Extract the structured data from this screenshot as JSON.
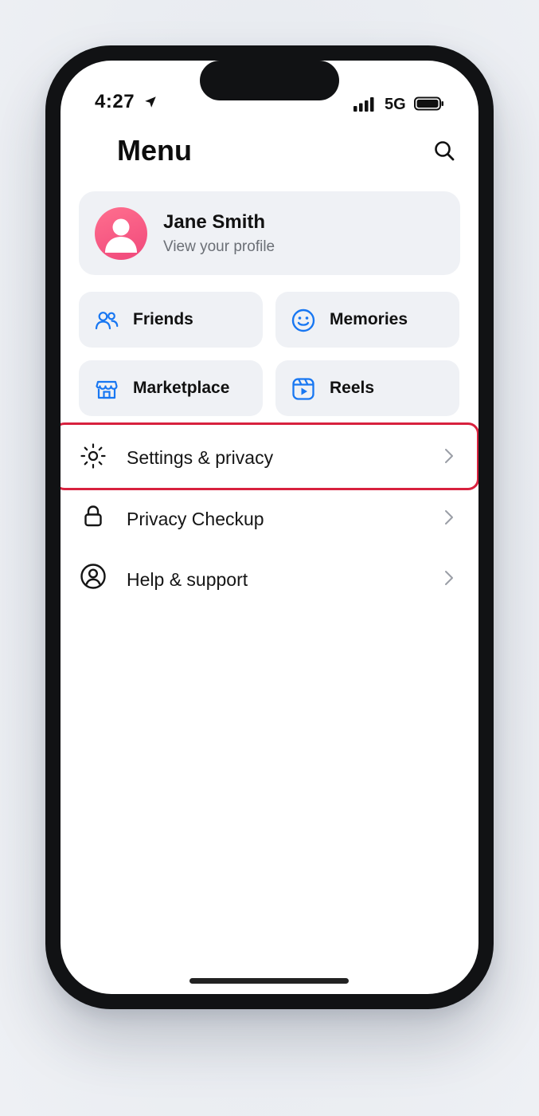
{
  "status_bar": {
    "time": "4:27",
    "network": "5G",
    "location_icon": "location-arrow-icon",
    "signal_icon": "cellular-signal-icon",
    "battery_icon": "battery-icon"
  },
  "header": {
    "title": "Menu",
    "search_icon": "search-icon"
  },
  "profile": {
    "name": "Jane Smith",
    "subtitle": "View your profile",
    "avatar_color": "#f0487b"
  },
  "shortcuts": [
    {
      "label": "Friends",
      "icon": "friends-icon"
    },
    {
      "label": "Memories",
      "icon": "memories-icon"
    },
    {
      "label": "Marketplace",
      "icon": "marketplace-icon"
    },
    {
      "label": "Reels",
      "icon": "reels-icon"
    }
  ],
  "menu_items": [
    {
      "label": "Settings & privacy",
      "icon": "gear-icon",
      "highlighted": true
    },
    {
      "label": "Privacy Checkup",
      "icon": "lock-icon",
      "highlighted": false
    },
    {
      "label": "Help & support",
      "icon": "help-user-icon",
      "highlighted": false
    }
  ],
  "colors": {
    "accent": "#1877f2",
    "highlight": "#d8213e",
    "card_bg": "#eff1f5"
  }
}
